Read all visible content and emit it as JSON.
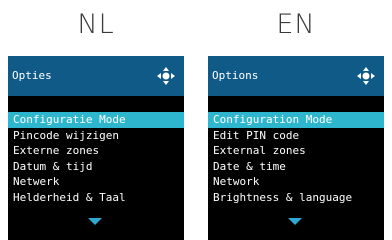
{
  "labels": {
    "nl": "NL",
    "en": "EN"
  },
  "screens": {
    "nl": {
      "title": "Opties",
      "items": [
        "Configuratie Mode",
        "Pincode wijzigen",
        "Externe zones",
        "Datum & tijd",
        "Netwerk",
        "Helderheid & Taal"
      ],
      "selected_index": 0
    },
    "en": {
      "title": "Options",
      "items": [
        "Configuration Mode",
        "Edit PIN code",
        "External zones",
        "Date & time",
        "Network",
        "Brightness & language"
      ],
      "selected_index": 0
    }
  },
  "icons": {
    "header": "dpad-icon",
    "footer": "down-arrow-icon"
  },
  "colors": {
    "header_bg": "#0f5a86",
    "selected_bg": "#2fb6cf",
    "screen_bg": "#000000",
    "accent": "#2ea9d1"
  }
}
